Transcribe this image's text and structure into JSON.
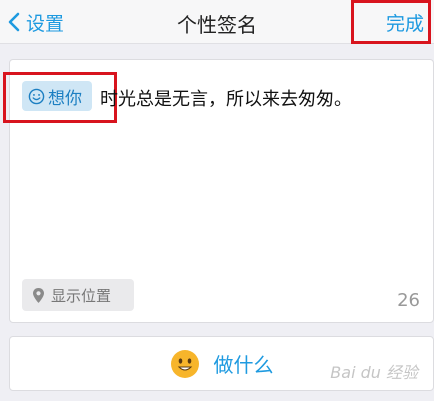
{
  "navbar": {
    "back_label": "设置",
    "title": "个性签名",
    "done_label": "完成"
  },
  "editor": {
    "mood_tag": "想你",
    "signature_text": "时光总是无言，所以来去匆匆。",
    "location_label": "显示位置",
    "char_count": "26"
  },
  "doing": {
    "label": "做什么"
  },
  "watermark": "Bai du 经验",
  "icons": {
    "back": "chevron-left-icon",
    "mood": "smile-icon",
    "location": "location-pin-icon",
    "doing": "smiley-emoji-icon"
  },
  "colors": {
    "accent": "#1e9ae0",
    "highlight": "#d8141e",
    "emoji": "#f7b52b"
  }
}
